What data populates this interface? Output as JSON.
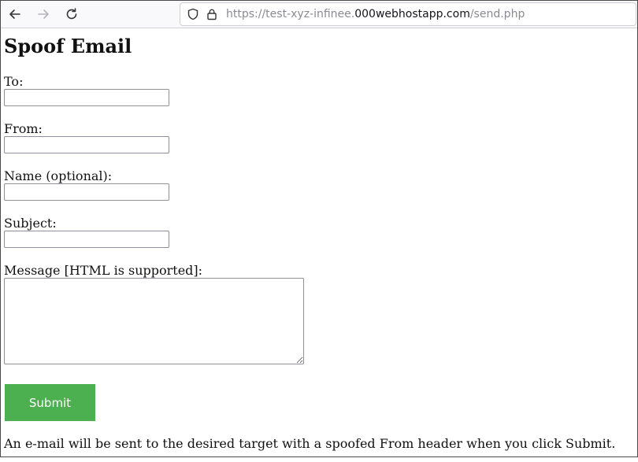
{
  "browser": {
    "url_prefix": "https://test-xyz-infinee.",
    "url_host": "000webhostapp.com",
    "url_path": "/send.php",
    "icons": {
      "back": "arrow-left-icon",
      "forward": "arrow-right-icon",
      "reload": "reload-icon",
      "shield": "shield-icon",
      "lock": "lock-icon"
    }
  },
  "page": {
    "title": "Spoof Email",
    "fields": {
      "to_label": "To:",
      "to_value": "",
      "from_label": "From:",
      "from_value": "",
      "name_label": "Name (optional):",
      "name_value": "",
      "subject_label": "Subject:",
      "subject_value": "",
      "message_label": "Message [HTML is supported]:",
      "message_value": ""
    },
    "submit_label": "Submit",
    "submit_color": "#4caf50",
    "footer_note": "An e-mail will be sent to the desired target with a spoofed From header when you click Submit."
  }
}
